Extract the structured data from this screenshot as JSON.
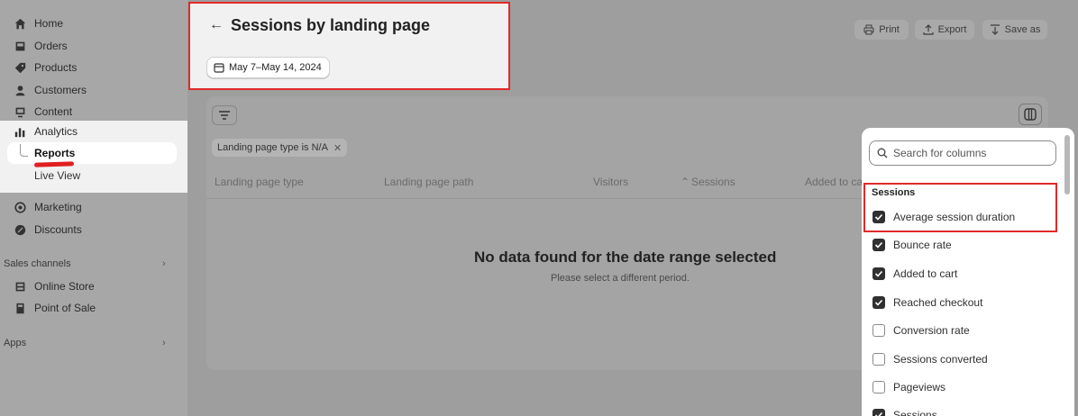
{
  "sidebar": {
    "items": [
      {
        "label": "Home",
        "icon": "home-icon"
      },
      {
        "label": "Orders",
        "icon": "orders-icon"
      },
      {
        "label": "Products",
        "icon": "tag-icon"
      },
      {
        "label": "Customers",
        "icon": "person-icon"
      },
      {
        "label": "Content",
        "icon": "content-icon"
      },
      {
        "label": "Analytics",
        "icon": "analytics-icon"
      }
    ],
    "analytics_sub": [
      {
        "label": "Reports",
        "active": true
      },
      {
        "label": "Live View",
        "active": false
      }
    ],
    "more_items": [
      {
        "label": "Marketing",
        "icon": "target-icon"
      },
      {
        "label": "Discounts",
        "icon": "discount-icon"
      }
    ],
    "sales_channels_label": "Sales channels",
    "sales_channels": [
      {
        "label": "Online Store",
        "icon": "store-icon"
      },
      {
        "label": "Point of Sale",
        "icon": "pos-icon"
      }
    ],
    "apps_label": "Apps"
  },
  "header": {
    "back_arrow": "←",
    "title": "Sessions by landing page",
    "date_range": "May 7–May 14, 2024",
    "actions": {
      "print": "Print",
      "export": "Export",
      "save_as": "Save as"
    }
  },
  "table": {
    "filter_tag": "Landing page type is N/A",
    "columns": [
      "Landing page type",
      "Landing page path",
      "Visitors",
      "Sessions",
      "Added to ca"
    ],
    "sort_indicator": "⌃",
    "empty_title": "No data found for the date range selected",
    "empty_subtitle": "Please select a different period."
  },
  "column_picker": {
    "search_placeholder": "Search for columns",
    "section": "Sessions",
    "options": [
      {
        "label": "Average session duration",
        "checked": true
      },
      {
        "label": "Bounce rate",
        "checked": true
      },
      {
        "label": "Added to cart",
        "checked": true
      },
      {
        "label": "Reached checkout",
        "checked": true
      },
      {
        "label": "Conversion rate",
        "checked": false
      },
      {
        "label": "Sessions converted",
        "checked": false
      },
      {
        "label": "Pageviews",
        "checked": false
      },
      {
        "label": "Sessions",
        "checked": true
      }
    ]
  },
  "colors": {
    "highlight": "#e02a2a",
    "overlay": "#9e9e9e",
    "checkbox_on": "#303030"
  }
}
